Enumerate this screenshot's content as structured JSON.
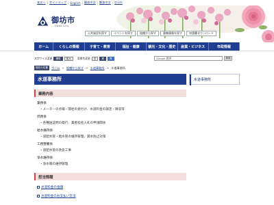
{
  "util_links": [
    "本文へ",
    "サイトマップ",
    "English",
    "簡体中文",
    "繁体中文",
    "한국어"
  ],
  "site": {
    "name": "御坊市",
    "name_en": "Gobo City"
  },
  "quick_links": [
    "公共施設を探す",
    "イベントを探す",
    "組織から探す",
    "募集情報を探す",
    "申請書ダウンロード"
  ],
  "nav": [
    "ホーム",
    "くらしの情報",
    "子育て・教育",
    "福祉・健康",
    "観光・文化・歴史",
    "産業・ビジネス",
    "市政情報"
  ],
  "tools": {
    "font_size_label": "文字サイズ変更",
    "standard": "標準",
    "enlarge": "拡大",
    "bg_color_label": "背景色変更",
    "white": "白",
    "black": "黒",
    "blue": "青"
  },
  "search": {
    "placeholder": "Google 提供",
    "button": "検索"
  },
  "breadcrumb": {
    "here_label": "現在の位置",
    "items": [
      "ホーム",
      "組織から探す",
      "水道事務所"
    ],
    "current": "水道事務所"
  },
  "page_title": "水道事務所",
  "duties": {
    "heading": "業務内容",
    "groups": [
      {
        "name": "業務係",
        "items": [
          "メーターの点検・開栓の受付け、水道料金の調定・徴収等"
        ]
      },
      {
        "name": "庶務係",
        "items": [
          "各種送証明の発行、業者指名入札の申請関係"
        ]
      },
      {
        "name": "給水維持係",
        "items": [
          "道配水管・給水管の維持管理、漏水防止対策"
        ]
      },
      {
        "name": "工務整備係",
        "items": [
          "道配水管の改良工事"
        ]
      },
      {
        "name": "浄水維持係",
        "items": [
          "浄水場の維持管理"
        ]
      }
    ]
  },
  "info": {
    "heading": "担当情報",
    "links": [
      "水道料金の金額",
      "水道料金のお支払い方法"
    ]
  },
  "sidebar": {
    "item": "水道事務所"
  },
  "colors": {
    "nav": "#1f3e91",
    "section_bg": "#f3dede",
    "accent": "#cc4444"
  }
}
